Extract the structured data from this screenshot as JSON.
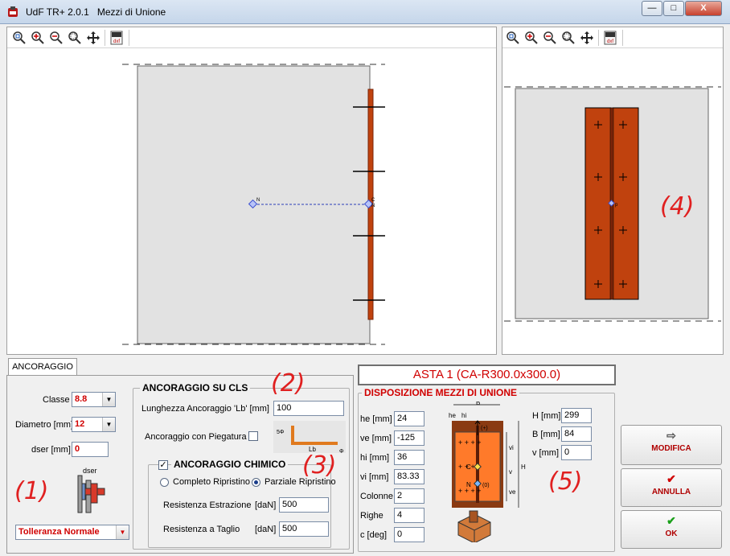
{
  "window": {
    "app_name": "UdF TR+ 2.0.1",
    "title": "Mezzi di Unione",
    "min_btn": "—",
    "max_btn": "□",
    "close_btn": "X"
  },
  "view_left": {
    "node_label_1": "N",
    "node_label_2": "C",
    "node_label_3": "N"
  },
  "view_right": {
    "node_label": "p"
  },
  "toolbar": {
    "dxf_label": "dxf"
  },
  "tab": {
    "label": "ANCORAGGIO"
  },
  "left_form": {
    "classe_label": "Classe",
    "classe_value": "8.8",
    "diametro_label": "Diametro [mm]",
    "diametro_value": "12",
    "dser_label": "dser [mm]",
    "dser_value": "0",
    "diagram_label": "dser",
    "tolleranza_value": "Tolleranza Normale"
  },
  "ancoraggio_cls": {
    "title": "ANCORAGGIO SU CLS",
    "lunghezza_label": "Lunghezza Ancoraggio 'Lb'  [mm]",
    "lunghezza_value": "100",
    "piegatura_label": "Ancoraggio con Piegatura",
    "diagram_5phi": "5Φ",
    "diagram_lb": "Lb",
    "diagram_phi": "Φ"
  },
  "ancoraggio_chimico": {
    "title": "ANCORAGGIO CHIMICO",
    "completo_label": "Completo Ripristino",
    "parziale_label": "Parziale Ripristino",
    "estrazione_label": "Resistenza Estrazione",
    "estrazione_unit": "[daN]",
    "estrazione_value": "500",
    "taglio_label": "Resistenza a Taglio",
    "taglio_unit": "[daN]",
    "taglio_value": "500"
  },
  "asta": {
    "title": "ASTA 1 (CA-R300.0x300.0)"
  },
  "disposizione": {
    "title": "DISPOSIZIONE MEZZI DI UNIONE",
    "fields_left": [
      {
        "label": "he [mm]",
        "value": "24"
      },
      {
        "label": "ve [mm]",
        "value": "-125"
      },
      {
        "label": "hi [mm]",
        "value": "36"
      },
      {
        "label": "vi [mm]",
        "value": "83.33"
      },
      {
        "label": "Colonne",
        "value": "2"
      },
      {
        "label": "Righe",
        "value": "4"
      },
      {
        "label": "c [deg]",
        "value": "0"
      }
    ],
    "fields_right": [
      {
        "label": "H [mm]",
        "value": "299"
      },
      {
        "label": "B [mm]",
        "value": "84"
      },
      {
        "label": "v [mm]",
        "value": "0"
      }
    ],
    "diagram": {
      "B": "B",
      "he": "he",
      "hi": "hi",
      "H": "H",
      "vi": "vi",
      "v": "v",
      "ve": "ve",
      "plus": "(+)",
      "C": "C",
      "N": "N",
      "zero": "(0)"
    }
  },
  "annotations": [
    "(1)",
    "(2)",
    "(3)",
    "(4)",
    "(5)"
  ],
  "buttons": {
    "modifica": "MODIFICA",
    "annulla": "ANNULLA",
    "ok": "OK"
  },
  "colors": {
    "steel": "#c0420e",
    "steel_dark": "#7a2408",
    "concrete": "#e2e2e2",
    "annotation": "#e02020",
    "node": "#5b6fe0",
    "connection": "#ff7a2a"
  }
}
